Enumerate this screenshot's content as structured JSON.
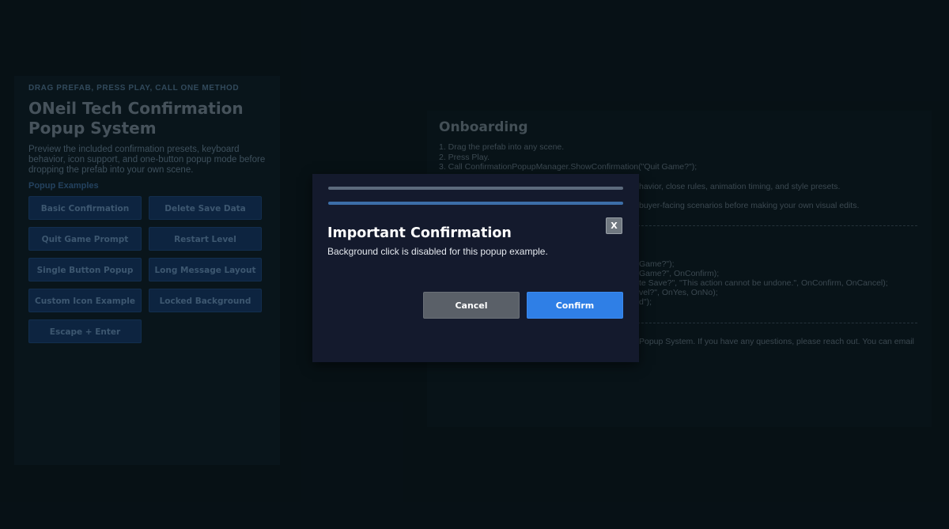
{
  "left_panel": {
    "eyebrow": "DRAG PREFAB, PRESS PLAY, CALL ONE METHOD",
    "title_line1": "ONeil Tech Confirmation",
    "title_line2": "Popup System",
    "description": "Preview the included confirmation presets, keyboard behavior, icon support, and one-button popup mode before dropping the prefab into your own scene.",
    "section_label": "Popup Examples",
    "buttons": [
      "Basic Confirmation",
      "Delete Save Data",
      "Quit Game Prompt",
      "Restart Level",
      "Single Button Popup",
      "Long Message Layout",
      "Custom Icon Example",
      "Locked Background",
      "Escape + Enter"
    ]
  },
  "right_panel": {
    "title": "Onboarding",
    "steps": [
      "1. Drag the prefab into any scene.",
      "2. Press Play.",
      "3. Call ConfirmationPopupManager.ShowConfirmation(\"Quit Game?\");"
    ],
    "partial_lines": {
      "line_a": "havior, close rules, animation timing, and style presets.",
      "line_b": "buyer-facing scenarios before making your own visual edits.",
      "code_1": "Game?\");",
      "code_2": "Game?\", OnConfirm);",
      "code_3": "te Save?\", \"This action cannot be undone.\", OnConfirm, OnCancel);",
      "code_4": "vel?\", OnYes, OnNo);",
      "code_5": "d\");",
      "footer": "Popup System. If you have any questions, please reach out. You can email"
    }
  },
  "modal": {
    "title": "Important Confirmation",
    "message": "Background click is disabled for this popup example.",
    "close_label": "X",
    "cancel_label": "Cancel",
    "confirm_label": "Confirm"
  },
  "colors": {
    "background": "#0b161b",
    "modal_background": "#141a2d",
    "confirm_accent": "#2f7fe6",
    "cancel_gray": "#5a6068",
    "example_button": "#14345d"
  }
}
